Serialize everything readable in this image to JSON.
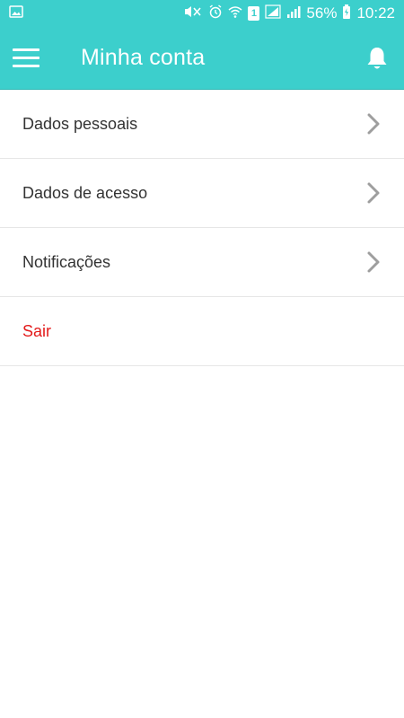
{
  "status_bar": {
    "battery_percent": "56%",
    "time": "10:22",
    "sim_slot": "1",
    "icons": [
      "gallery-icon",
      "mute-icon",
      "alarm-icon",
      "wifi-icon",
      "sim-icon",
      "signal-icon",
      "battery-icon"
    ]
  },
  "app_bar": {
    "title": "Minha conta",
    "menu_icon": "hamburger-menu-icon",
    "notifications_icon": "bell-icon"
  },
  "menu": {
    "items": [
      {
        "label": "Dados pessoais",
        "has_chevron": true
      },
      {
        "label": "Dados de acesso",
        "has_chevron": true
      },
      {
        "label": "Notificações",
        "has_chevron": true
      },
      {
        "label": "Sair",
        "has_chevron": false
      }
    ]
  },
  "colors": {
    "primary": "#3ccfcc",
    "logout_text": "#e31b1b",
    "text": "#333333",
    "chevron": "#9e9e9e",
    "divider": "#e6e6e6"
  }
}
